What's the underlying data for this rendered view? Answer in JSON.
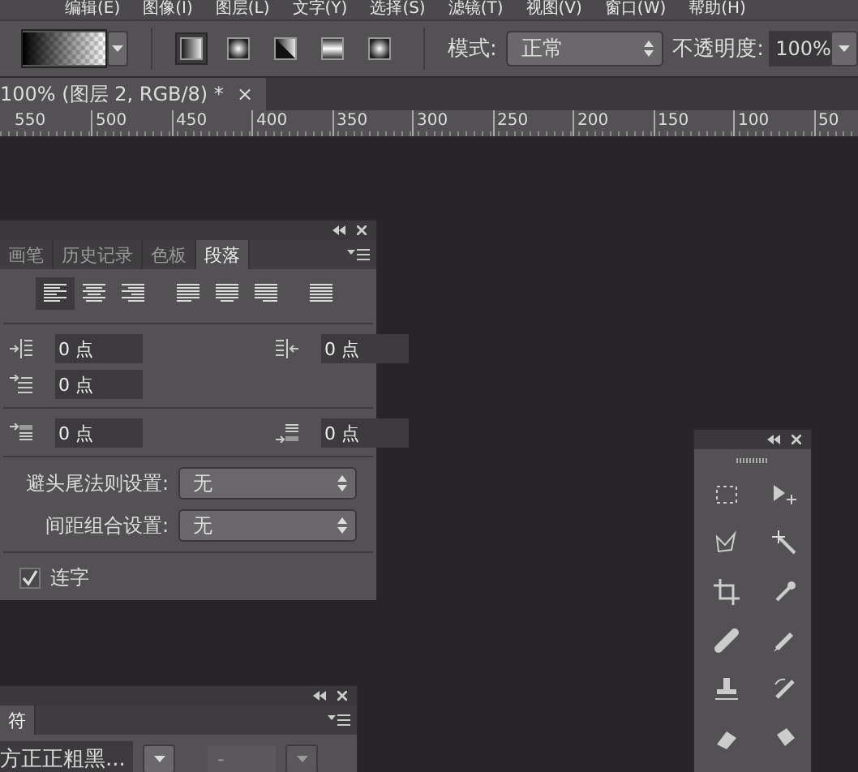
{
  "menu_bar": [
    "编辑(E)",
    "图像(I)",
    "图层(L)",
    "文字(Y)",
    "选择(S)",
    "滤镜(T)",
    "视图(V)",
    "窗口(W)",
    "帮助(H)"
  ],
  "options_bar": {
    "gradient_types": [
      {
        "kind": "linear",
        "selected": true
      },
      {
        "kind": "radial",
        "selected": false
      },
      {
        "kind": "angle",
        "selected": false
      },
      {
        "kind": "reflected",
        "selected": false
      },
      {
        "kind": "diamond",
        "selected": false
      }
    ],
    "mode_label": "模式:",
    "mode_value": "正常",
    "opacity_label": "不透明度:",
    "opacity_value": "100%"
  },
  "document_tab": {
    "title": "100% (图层 2, RGB/8) *",
    "close": "×"
  },
  "ruler": [
    "550",
    "500",
    "450",
    "400",
    "350",
    "300",
    "250",
    "200",
    "150",
    "100",
    "50"
  ],
  "paragraph_panel": {
    "tabs": [
      {
        "label": "画笔",
        "selected": false
      },
      {
        "label": "历史记录",
        "selected": false
      },
      {
        "label": "色板",
        "selected": false
      },
      {
        "label": "段落",
        "selected": true
      }
    ],
    "alignment": [
      {
        "kind": "left",
        "selected": true
      },
      {
        "kind": "center",
        "selected": false
      },
      {
        "kind": "right",
        "selected": false
      },
      {
        "kind": "justify-left",
        "selected": false
      },
      {
        "kind": "justify-center",
        "selected": false
      },
      {
        "kind": "justify-right",
        "selected": false
      },
      {
        "kind": "justify-all",
        "selected": false
      }
    ],
    "indent_left": "0 点",
    "indent_right": "0 点",
    "indent_first": "0 点",
    "space_before": "0 点",
    "space_after": "0 点",
    "kinsoku_label": "避头尾法则设置:",
    "kinsoku_value": "无",
    "mojikumi_label": "间距组合设置:",
    "mojikumi_value": "无",
    "hyphenate": {
      "label": "连字",
      "checked": true
    }
  },
  "character_panel": {
    "tab": "符",
    "font": "方正正粗黑...",
    "style": "-"
  }
}
